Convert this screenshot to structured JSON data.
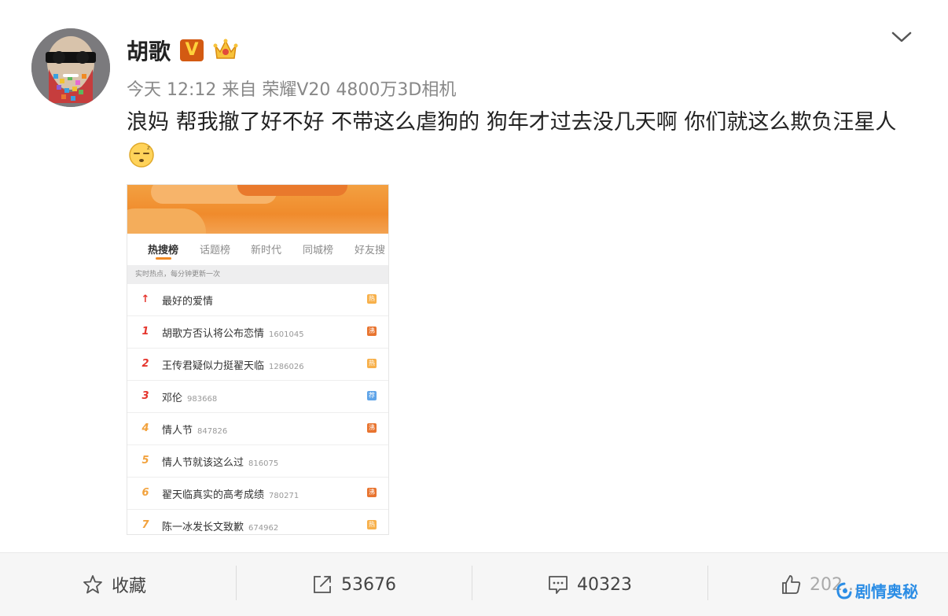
{
  "post": {
    "author": "胡歌",
    "verified_badge": "V",
    "meta": "今天 12:12 来自 荣耀V20 4800万3D相机",
    "body": "浪妈 帮我撤了好不好 不带这么虐狗的 狗年才过去没几天啊 你们就这么欺负汪星人"
  },
  "screenshot": {
    "tabs": [
      "热搜榜",
      "话题榜",
      "新时代",
      "同城榜",
      "好友搜"
    ],
    "subheader": "实时热点，每分钟更新一次",
    "rows": [
      {
        "rank": "↑",
        "title": "最好的爱情",
        "count": "",
        "tag": "热"
      },
      {
        "rank": "1",
        "title": "胡歌方否认将公布恋情",
        "count": "1601045",
        "tag": "沸"
      },
      {
        "rank": "2",
        "title": "王传君疑似力挺翟天临",
        "count": "1286026",
        "tag": "热"
      },
      {
        "rank": "3",
        "title": "邓伦",
        "count": "983668",
        "tag": "荐"
      },
      {
        "rank": "4",
        "title": "情人节",
        "count": "847826",
        "tag": "沸"
      },
      {
        "rank": "5",
        "title": "情人节就该这么过",
        "count": "816075",
        "tag": ""
      },
      {
        "rank": "6",
        "title": "翟天临真实的高考成绩",
        "count": "780271",
        "tag": "沸"
      },
      {
        "rank": "7",
        "title": "陈一冰发长文致歉",
        "count": "674962",
        "tag": "热"
      }
    ]
  },
  "actions": {
    "favorite_label": "收藏",
    "repost_count": "53676",
    "comment_count": "40323",
    "like_count": "202..."
  },
  "watermark": "剧情奥秘",
  "colors": {
    "accent_orange": "#f08a24",
    "rank_red": "#e5352d",
    "rank_orange": "#f2a23d",
    "tag_hot": "#f7b04a",
    "tag_boil": "#e8742f",
    "tag_rec": "#5fa4e8",
    "watermark_blue": "#2b8de5"
  }
}
